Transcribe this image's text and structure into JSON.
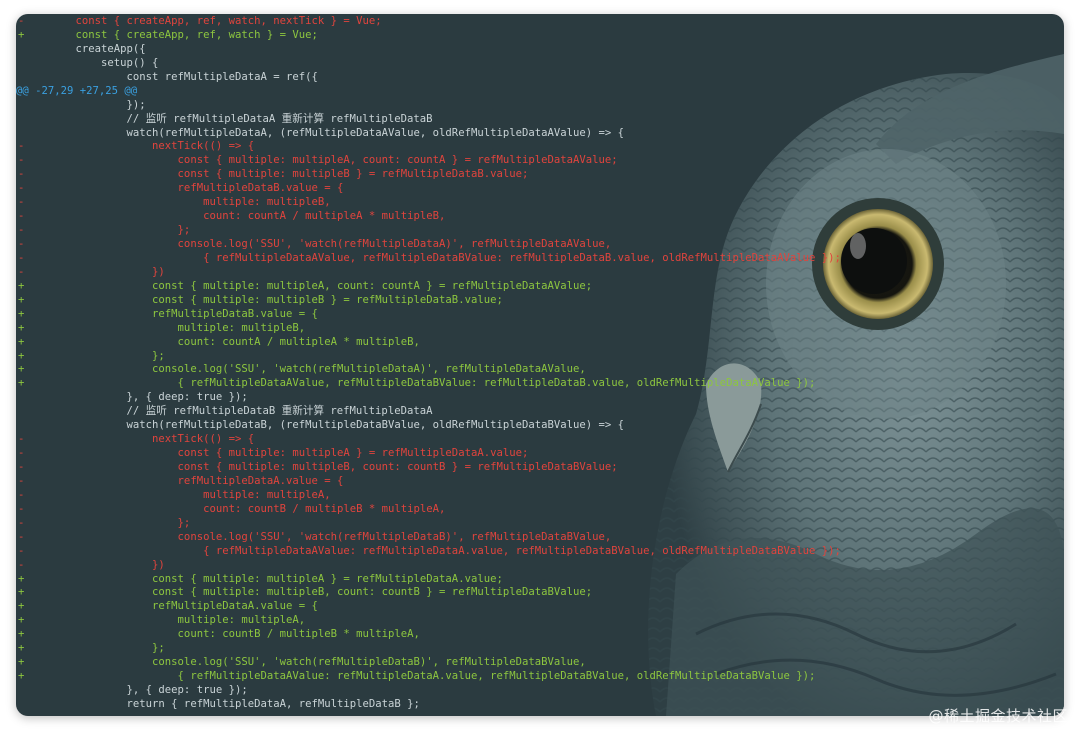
{
  "code_diff": {
    "lines": [
      {
        "type": "del",
        "marker": "-",
        "text": "    const { createApp, ref, watch, nextTick } = Vue;"
      },
      {
        "type": "add",
        "marker": "+",
        "text": "    const { createApp, ref, watch } = Vue;"
      },
      {
        "type": "ctx",
        "marker": "",
        "text": "    createApp({"
      },
      {
        "type": "ctx",
        "marker": "",
        "text": "        setup() {"
      },
      {
        "type": "ctx",
        "marker": "",
        "text": "            const refMultipleDataA = ref({"
      },
      {
        "type": "hunk",
        "marker": "",
        "text": "@@ -27,29 +27,25 @@"
      },
      {
        "type": "ctx",
        "marker": "",
        "text": "            });"
      },
      {
        "type": "ctx",
        "marker": "",
        "text": "            // 监听 refMultipleDataA 重新计算 refMultipleDataB"
      },
      {
        "type": "ctx",
        "marker": "",
        "text": "            watch(refMultipleDataA, (refMultipleDataAValue, oldRefMultipleDataAValue) => {"
      },
      {
        "type": "del",
        "marker": "-",
        "text": "                nextTick(() => {"
      },
      {
        "type": "del",
        "marker": "-",
        "text": "                    const { multiple: multipleA, count: countA } = refMultipleDataAValue;"
      },
      {
        "type": "del",
        "marker": "-",
        "text": "                    const { multiple: multipleB } = refMultipleDataB.value;"
      },
      {
        "type": "del",
        "marker": "-",
        "text": "                    refMultipleDataB.value = {"
      },
      {
        "type": "del",
        "marker": "-",
        "text": "                        multiple: multipleB,"
      },
      {
        "type": "del",
        "marker": "-",
        "text": "                        count: countA / multipleA * multipleB,"
      },
      {
        "type": "del",
        "marker": "-",
        "text": "                    };"
      },
      {
        "type": "del",
        "marker": "-",
        "text": "                    console.log('SSU', 'watch(refMultipleDataA)', refMultipleDataAValue,"
      },
      {
        "type": "del",
        "marker": "-",
        "text": "                        { refMultipleDataAValue, refMultipleDataBValue: refMultipleDataB.value, oldRefMultipleDataAValue });"
      },
      {
        "type": "del",
        "marker": "-",
        "text": "                })"
      },
      {
        "type": "add",
        "marker": "+",
        "text": "                const { multiple: multipleA, count: countA } = refMultipleDataAValue;"
      },
      {
        "type": "add",
        "marker": "+",
        "text": "                const { multiple: multipleB } = refMultipleDataB.value;"
      },
      {
        "type": "add",
        "marker": "+",
        "text": "                refMultipleDataB.value = {"
      },
      {
        "type": "add",
        "marker": "+",
        "text": "                    multiple: multipleB,"
      },
      {
        "type": "add",
        "marker": "+",
        "text": "                    count: countA / multipleA * multipleB,"
      },
      {
        "type": "add",
        "marker": "+",
        "text": "                };"
      },
      {
        "type": "add",
        "marker": "+",
        "text": "                console.log('SSU', 'watch(refMultipleDataA)', refMultipleDataAValue,"
      },
      {
        "type": "add",
        "marker": "+",
        "text": "                    { refMultipleDataAValue, refMultipleDataBValue: refMultipleDataB.value, oldRefMultipleDataAValue });"
      },
      {
        "type": "ctx",
        "marker": "",
        "text": "            }, { deep: true });"
      },
      {
        "type": "ctx",
        "marker": "",
        "text": "            // 监听 refMultipleDataB 重新计算 refMultipleDataA"
      },
      {
        "type": "ctx",
        "marker": "",
        "text": "            watch(refMultipleDataB, (refMultipleDataBValue, oldRefMultipleDataBValue) => {"
      },
      {
        "type": "del",
        "marker": "-",
        "text": "                nextTick(() => {"
      },
      {
        "type": "del",
        "marker": "-",
        "text": "                    const { multiple: multipleA } = refMultipleDataA.value;"
      },
      {
        "type": "del",
        "marker": "-",
        "text": "                    const { multiple: multipleB, count: countB } = refMultipleDataBValue;"
      },
      {
        "type": "del",
        "marker": "-",
        "text": "                    refMultipleDataA.value = {"
      },
      {
        "type": "del",
        "marker": "-",
        "text": "                        multiple: multipleA,"
      },
      {
        "type": "del",
        "marker": "-",
        "text": "                        count: countB / multipleB * multipleA,"
      },
      {
        "type": "del",
        "marker": "-",
        "text": "                    };"
      },
      {
        "type": "del",
        "marker": "-",
        "text": "                    console.log('SSU', 'watch(refMultipleDataB)', refMultipleDataBValue,"
      },
      {
        "type": "del",
        "marker": "-",
        "text": "                        { refMultipleDataAValue: refMultipleDataA.value, refMultipleDataBValue, oldRefMultipleDataBValue });"
      },
      {
        "type": "del",
        "marker": "-",
        "text": "                })"
      },
      {
        "type": "add",
        "marker": "+",
        "text": "                const { multiple: multipleA } = refMultipleDataA.value;"
      },
      {
        "type": "add",
        "marker": "+",
        "text": "                const { multiple: multipleB, count: countB } = refMultipleDataBValue;"
      },
      {
        "type": "add",
        "marker": "+",
        "text": "                refMultipleDataA.value = {"
      },
      {
        "type": "add",
        "marker": "+",
        "text": "                    multiple: multipleA,"
      },
      {
        "type": "add",
        "marker": "+",
        "text": "                    count: countB / multipleB * multipleA,"
      },
      {
        "type": "add",
        "marker": "+",
        "text": "                };"
      },
      {
        "type": "add",
        "marker": "+",
        "text": "                console.log('SSU', 'watch(refMultipleDataB)', refMultipleDataBValue,"
      },
      {
        "type": "add",
        "marker": "+",
        "text": "                    { refMultipleDataAValue: refMultipleDataA.value, refMultipleDataBValue, oldRefMultipleDataBValue });"
      },
      {
        "type": "ctx",
        "marker": "",
        "text": "            }, { deep: true });"
      },
      {
        "type": "ctx",
        "marker": "",
        "text": "            return { refMultipleDataA, refMultipleDataB };"
      }
    ]
  },
  "watermark": "@稀土掘金技术社区",
  "colors": {
    "background": "#2b3b40",
    "deleted": "#e0443d",
    "added": "#8dc63f",
    "hunk_header": "#3aa0e0",
    "context": "#c9d3d6"
  },
  "icons": [
    "owl-image"
  ]
}
